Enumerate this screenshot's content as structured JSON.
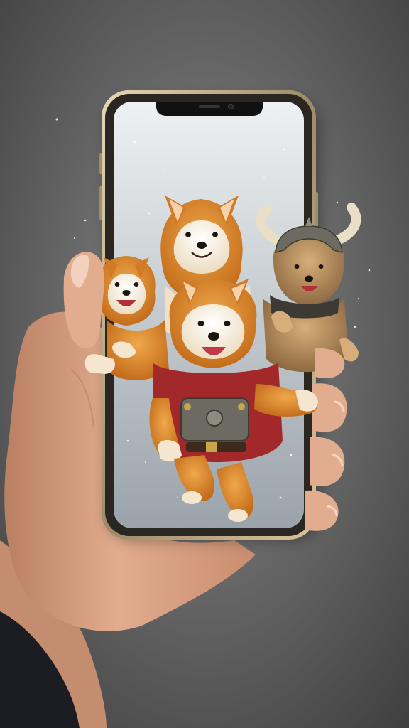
{
  "scene": {
    "kind": "photo-illustration",
    "subject_icons": [
      "hand-icon",
      "smartphone-icon",
      "shiba-inu-dog-icon",
      "viking-helmet-icon",
      "sparkle-icon"
    ],
    "dog_count": 4,
    "colors": {
      "backdrop_center": "#8a8a8a",
      "backdrop_edge": "#3e3e3e",
      "phone_frame": "#2a2622",
      "phone_rim": "#c9b48a",
      "screen_top": "#eef1f3",
      "screen_bottom": "#9aa3aa",
      "skin": "#e2ac8e",
      "skin_shadow": "#b97f62",
      "sleeve": "#1c1d22",
      "fur_orange": "#e08a2e",
      "fur_cream": "#f4e6cf",
      "armor_red": "#a3282a",
      "armor_metal": "#6d6a62",
      "horn": "#e9dfc7"
    }
  }
}
